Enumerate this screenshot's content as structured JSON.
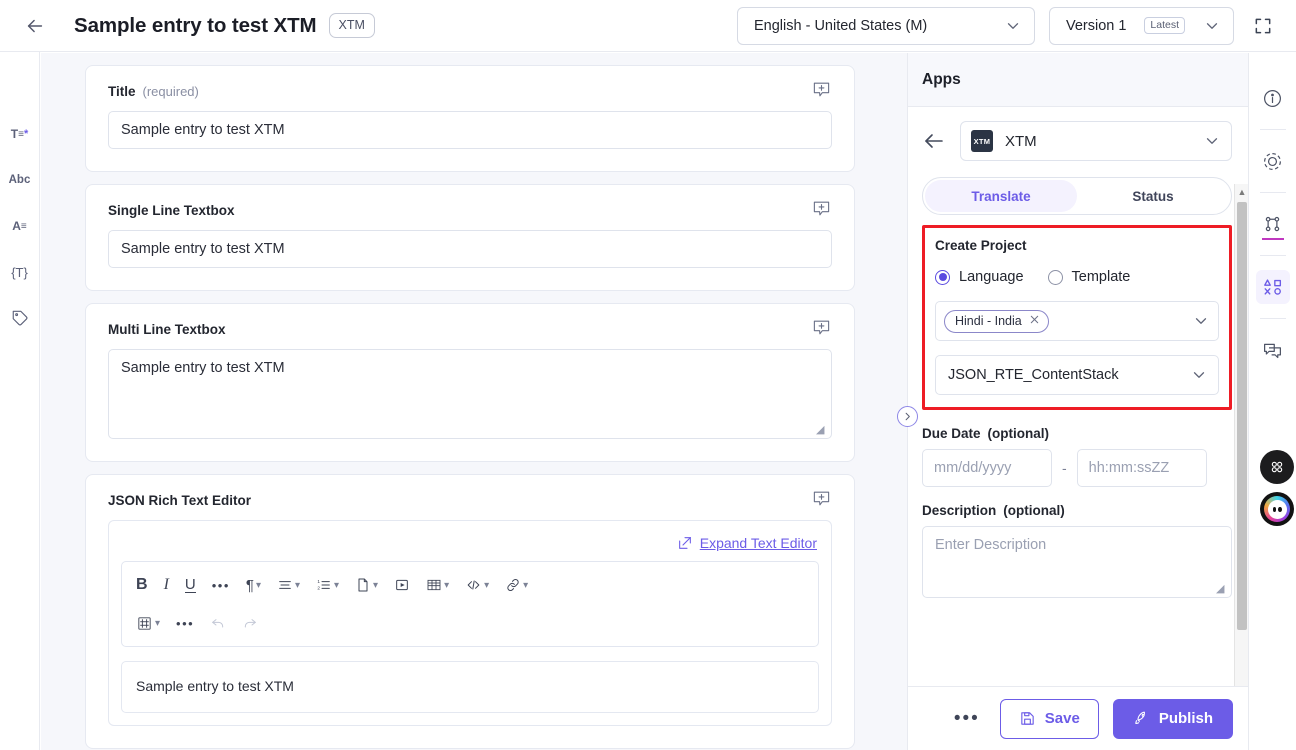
{
  "topbar": {
    "back_icon": "arrow-left-icon",
    "title": "Sample entry to test XTM",
    "content_type_chip": "XTM",
    "locale_selector": {
      "value": "English - United States (M)",
      "icon": "chevron-down-icon"
    },
    "version_selector": {
      "value": "Version 1",
      "badge": "Latest",
      "icon": "chevron-down-icon"
    },
    "fullscreen_icon": "fullscreen-icon"
  },
  "left_rail": {
    "items": [
      {
        "name": "text-field-icon",
        "glyph": "T≡*"
      },
      {
        "name": "abc-icon",
        "glyph": "Abc"
      },
      {
        "name": "rich-text-icon",
        "glyph": "A≡"
      },
      {
        "name": "json-icon",
        "glyph": "{T}"
      },
      {
        "name": "tag-icon",
        "glyph": "tag"
      }
    ]
  },
  "form": {
    "fields": [
      {
        "label": "Title",
        "note": "(required)",
        "type": "single-line",
        "value": "Sample entry to test XTM",
        "comment_icon": "add-comment-icon"
      },
      {
        "label": "Single Line Textbox",
        "note": "",
        "type": "single-line",
        "value": "Sample entry to test XTM",
        "comment_icon": "add-comment-icon"
      },
      {
        "label": "Multi Line Textbox",
        "note": "",
        "type": "multi-line",
        "value": "Sample entry to test XTM",
        "comment_icon": "add-comment-icon"
      },
      {
        "label": "JSON Rich Text Editor",
        "note": "",
        "type": "rich-text",
        "value": "Sample entry to test XTM",
        "comment_icon": "add-comment-icon"
      }
    ],
    "expand_link": "Expand Text Editor",
    "expand_icon": "expand-arrow-icon",
    "toolbar": [
      {
        "name": "bold-button",
        "glyph": "B",
        "caret": false
      },
      {
        "name": "italic-button",
        "glyph": "I",
        "caret": false
      },
      {
        "name": "underline-button",
        "glyph": "U",
        "caret": false
      },
      {
        "name": "more-text-styles-button",
        "glyph": "•••",
        "caret": false
      },
      {
        "name": "paragraph-style-button",
        "glyph": "¶",
        "caret": true
      },
      {
        "name": "text-align-button",
        "glyph": "align",
        "caret": true
      },
      {
        "name": "ordered-list-button",
        "glyph": "list",
        "caret": true
      },
      {
        "name": "insert-file-button",
        "glyph": "file",
        "caret": true
      },
      {
        "name": "insert-embed-button",
        "glyph": "embed",
        "caret": false
      },
      {
        "name": "insert-table-button",
        "glyph": "table",
        "caret": true
      },
      {
        "name": "code-button",
        "glyph": "code",
        "caret": true
      },
      {
        "name": "link-button",
        "glyph": "link",
        "caret": true
      },
      {
        "name": "fragment-button",
        "glyph": "hash",
        "caret": true
      },
      {
        "name": "more-options-button",
        "glyph": "•••",
        "caret": false
      },
      {
        "name": "undo-button",
        "glyph": "undo",
        "caret": false,
        "disabled": true
      },
      {
        "name": "redo-button",
        "glyph": "redo",
        "caret": false,
        "disabled": true
      }
    ]
  },
  "apps_panel": {
    "header": "Apps",
    "back_icon": "arrow-left-icon",
    "app_selector": {
      "logo_text": "XTM",
      "name": "XTM",
      "icon": "chevron-down-icon"
    },
    "tabs": [
      {
        "label": "Translate",
        "active": true
      },
      {
        "label": "Status",
        "active": false
      }
    ],
    "create_project": {
      "title": "Create Project",
      "radios": [
        {
          "label": "Language",
          "selected": true
        },
        {
          "label": "Template",
          "selected": false
        }
      ],
      "language_tokens": [
        {
          "label": "Hindi - India",
          "remove_icon": "close-icon"
        }
      ],
      "language_select_icon": "chevron-down-icon",
      "project_select": {
        "value": "JSON_RTE_ContentStack",
        "icon": "chevron-down-icon"
      }
    },
    "due_date": {
      "label": "Due Date",
      "note": "(optional)",
      "date_placeholder": "mm/dd/yyyy",
      "separator": "-",
      "time_placeholder": "hh:mm:ssZZ"
    },
    "description": {
      "label": "Description",
      "note": "(optional)",
      "placeholder": "Enter Description"
    },
    "highlight_color": "#ee1c25",
    "accent_color": "#6c5ce7"
  },
  "footer": {
    "more_label": "•••",
    "save_label": "Save",
    "save_icon": "save-icon",
    "publish_label": "Publish",
    "publish_icon": "rocket-icon"
  },
  "collapse_toggle_icon": "chevron-right-icon",
  "right_rail": {
    "items": [
      {
        "name": "info-icon",
        "active": false
      },
      {
        "name": "target-icon",
        "active": false
      },
      {
        "name": "references-icon",
        "active": false,
        "underline": true
      },
      {
        "name": "apps-icon",
        "active": true
      },
      {
        "name": "comments-icon",
        "active": false
      }
    ]
  },
  "floating": [
    {
      "name": "grid-menu-button"
    },
    {
      "name": "assistant-avatar-button"
    }
  ]
}
